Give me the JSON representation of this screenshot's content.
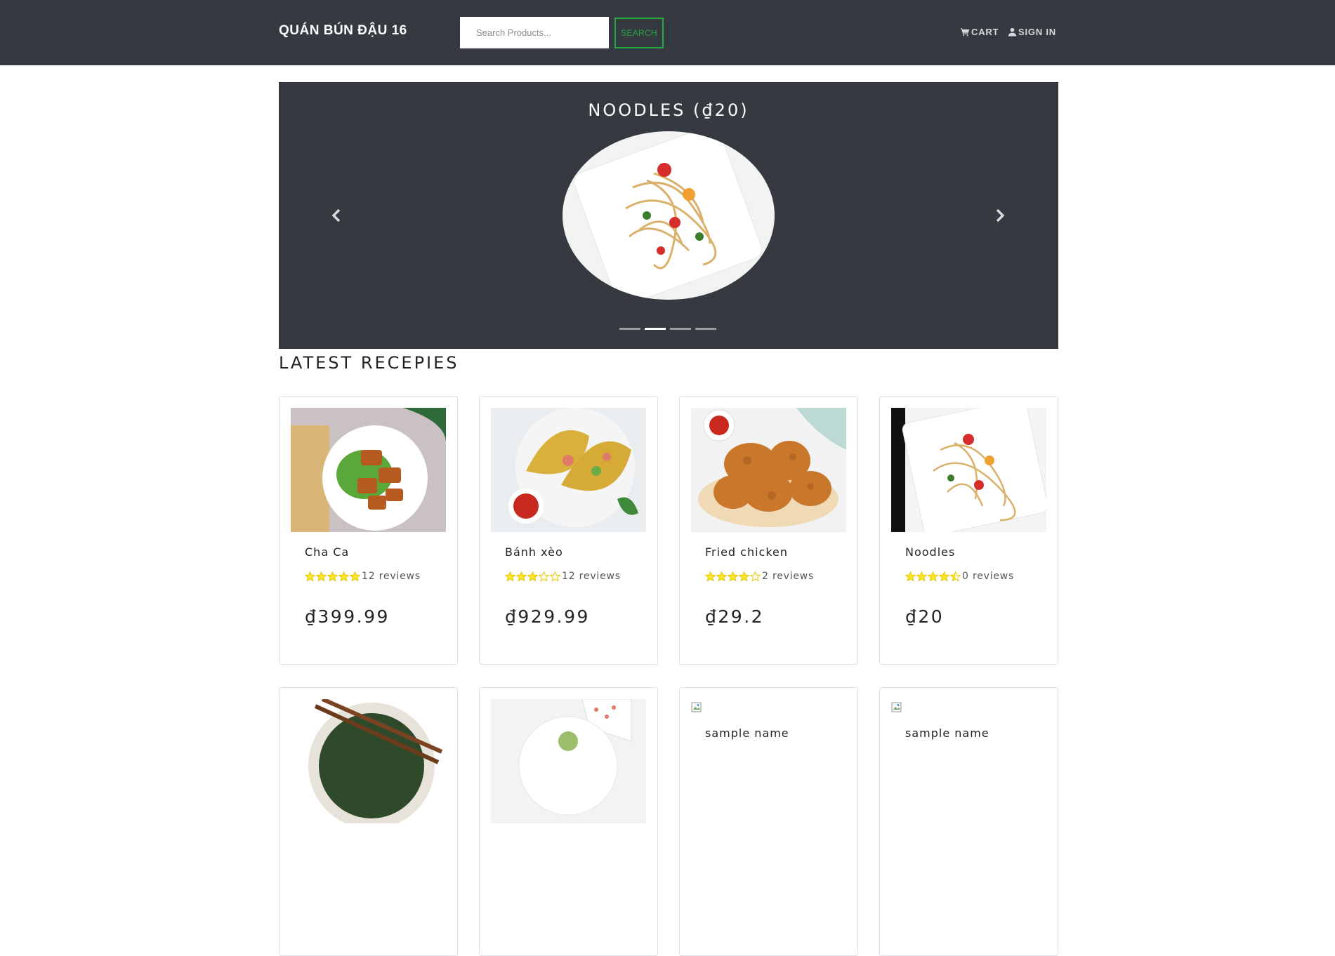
{
  "header": {
    "brand": "QUÁN BÚN ĐẬU 16",
    "search_placeholder": "Search Products...",
    "search_button": "SEARCH",
    "cart_label": "CART",
    "signin_label": "SIGN IN",
    "accent_color": "#28a745"
  },
  "carousel": {
    "title": "NOODLES (₫20)",
    "active_index": 1,
    "slide_count": 4
  },
  "section": {
    "title": "LATEST RECEPIES"
  },
  "products": [
    {
      "name": "Cha Ca",
      "rating": 5,
      "reviews": "12 reviews",
      "price": "₫399.99"
    },
    {
      "name": "Bánh xèo",
      "rating": 3,
      "reviews": "12 reviews",
      "price": "₫929.99"
    },
    {
      "name": "Fried chicken",
      "rating": 4,
      "reviews": "2 reviews",
      "price": "₫29.2"
    },
    {
      "name": "Noodles",
      "rating": 4.5,
      "reviews": "0 reviews",
      "price": "₫20"
    }
  ],
  "products_row2": [
    {
      "name": ""
    },
    {
      "name": ""
    },
    {
      "name": "sample name"
    },
    {
      "name": "sample name"
    }
  ]
}
